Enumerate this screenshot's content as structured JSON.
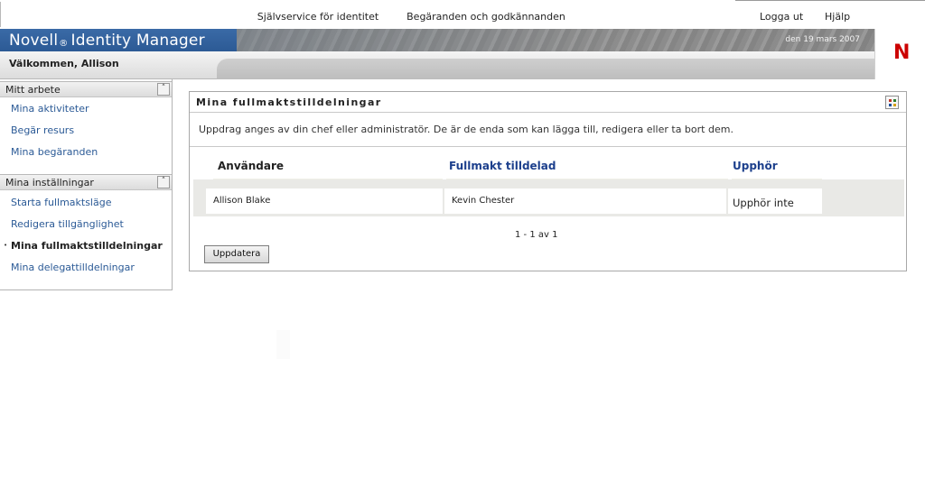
{
  "header": {
    "brand_name": "Novell",
    "brand_mark": "®",
    "product_name": "Identity Manager",
    "date": "den 19 mars 2007",
    "logo_letter": "N"
  },
  "nav": {
    "welcome": "Välkommen, Allison",
    "tabs": [
      {
        "label": "Självservice för identitet"
      },
      {
        "label": "Begäranden och godkännanden",
        "selected": true
      }
    ],
    "logout": "Logga ut",
    "help": "Hjälp"
  },
  "sidebar": {
    "sections": [
      {
        "title": "Mitt arbete",
        "items": [
          {
            "label": "Mina aktiviteter"
          },
          {
            "label": "Begär resurs"
          },
          {
            "label": "Mina begäranden"
          }
        ]
      },
      {
        "title": "Mina inställningar",
        "items": [
          {
            "label": "Starta fullmaktsläge"
          },
          {
            "label": "Redigera tillgänglighet"
          },
          {
            "label": "Mina fullmaktstilldelningar",
            "active": true
          },
          {
            "label": "Mina delegattilldelningar"
          }
        ]
      }
    ],
    "bullet": "•"
  },
  "panel": {
    "title": "Mina fullmaktstilldelningar",
    "description": "Uppdrag anges av din chef eller administratör. De är de enda som kan lägga till, redigera eller ta bort dem.",
    "columns": [
      "Användare",
      "Fullmakt tilldelad",
      "Upphör"
    ],
    "rows": [
      {
        "user": "Allison Blake",
        "proxy": "Kevin Chester",
        "expires": "Upphör inte"
      }
    ],
    "pagination": "1 - 1 av 1",
    "refresh_label": "Uppdatera",
    "icon": "grid-view-icon"
  },
  "colors": {
    "brand_blue": "#2c5a95",
    "link_blue": "#2b5a96",
    "header_blue": "#1c3f8c",
    "novell_red": "#cc0000"
  }
}
